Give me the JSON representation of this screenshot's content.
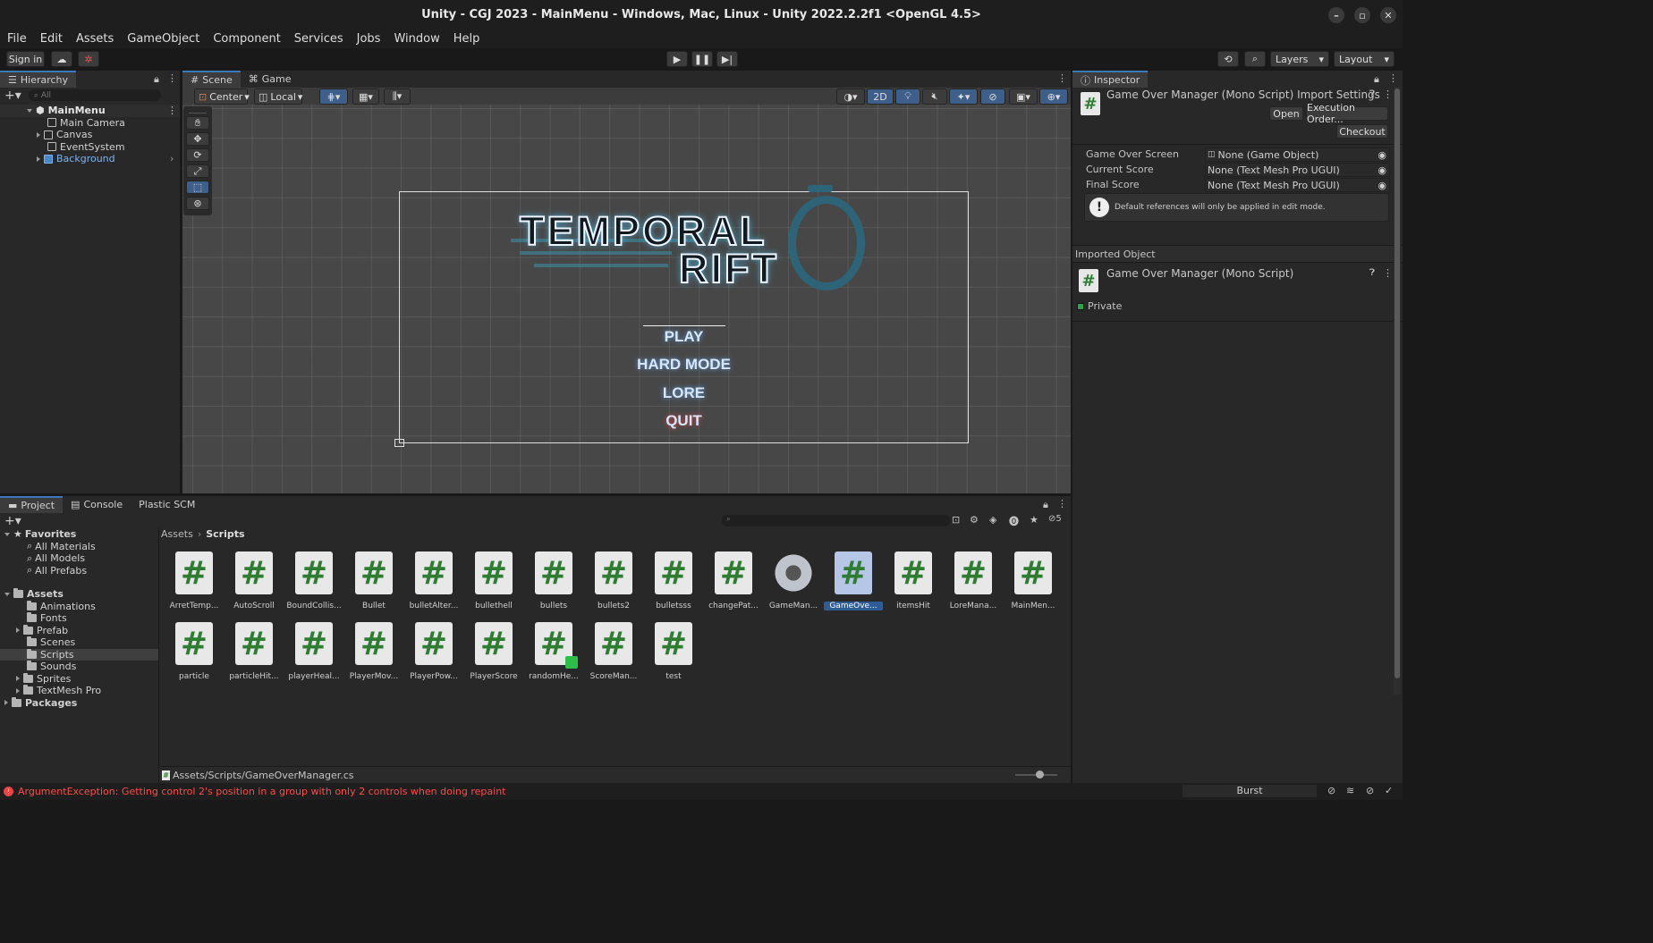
{
  "window": {
    "title": "Unity - CGJ 2023 - MainMenu - Windows, Mac, Linux - Unity 2022.2.2f1 <OpenGL 4.5>"
  },
  "menu": [
    "File",
    "Edit",
    "Assets",
    "GameObject",
    "Component",
    "Services",
    "Jobs",
    "Window",
    "Help"
  ],
  "toolbar": {
    "sign_in": "Sign in",
    "layers": "Layers",
    "layout": "Layout"
  },
  "hierarchy": {
    "tab": "Hierarchy",
    "search_placeholder": "All",
    "scene": "MainMenu",
    "items": [
      "Main Camera",
      "Canvas",
      "EventSystem",
      "Background"
    ]
  },
  "scene": {
    "tabs": [
      "Scene",
      "Game"
    ],
    "pivot": "Center",
    "space": "Local",
    "mode_2d": "2D",
    "logo_line1": "TEMPORAL",
    "logo_line2": "RIFT",
    "menu_items": [
      "PLAY",
      "HARD MODE",
      "LORE",
      "QUIT"
    ]
  },
  "inspector": {
    "tab": "Inspector",
    "title": "Game Over Manager (Mono Script) Import Settings",
    "open": "Open",
    "execution_order": "Execution Order...",
    "checkout": "Checkout",
    "fields": [
      {
        "label": "Game Over Screen",
        "value": "None (Game Object)"
      },
      {
        "label": "Current Score",
        "value": "None (Text Mesh Pro UGUI)"
      },
      {
        "label": "Final Score",
        "value": "None (Text Mesh Pro UGUI)"
      }
    ],
    "help_box": "Default references will only be applied in edit mode.",
    "imported_header": "Imported Object",
    "imported_title": "Game Over Manager (Mono Script)",
    "private_label": "Private"
  },
  "project": {
    "tabs": [
      "Project",
      "Console",
      "Plastic SCM"
    ],
    "hidden_count": "5",
    "favorites": {
      "label": "Favorites",
      "items": [
        "All Materials",
        "All Models",
        "All Prefabs"
      ]
    },
    "assets": {
      "label": "Assets",
      "items": [
        "Animations",
        "Fonts",
        "Prefab",
        "Scenes",
        "Scripts",
        "Sounds",
        "Sprites",
        "TextMesh Pro"
      ]
    },
    "packages": "Packages",
    "breadcrumb": [
      "Assets",
      "Scripts"
    ],
    "files": [
      "ArretTemp...",
      "AutoScroll",
      "BoundCollis...",
      "Bullet",
      "bulletAlter...",
      "bullethell",
      "bullets",
      "bullets2",
      "bulletsss",
      "changePat...",
      "GameMan...",
      "GameOve...",
      "itemsHit",
      "LoreMana...",
      "MainMen...",
      "particle",
      "particleHit...",
      "playerHeal...",
      "PlayerMov...",
      "PlayerPow...",
      "PlayerScore",
      "randomHe...",
      "ScoreMan...",
      "test"
    ],
    "path": "Assets/Scripts/GameOverManager.cs"
  },
  "status": {
    "error": "ArgumentException: Getting control 2's position in a group with only 2 controls when doing repaint",
    "burst": "Burst"
  },
  "colors": {
    "accent": "#3a79bb",
    "selection": "#2d5c94",
    "script_hash": "#2f7d32",
    "error": "#ff4b4b"
  }
}
